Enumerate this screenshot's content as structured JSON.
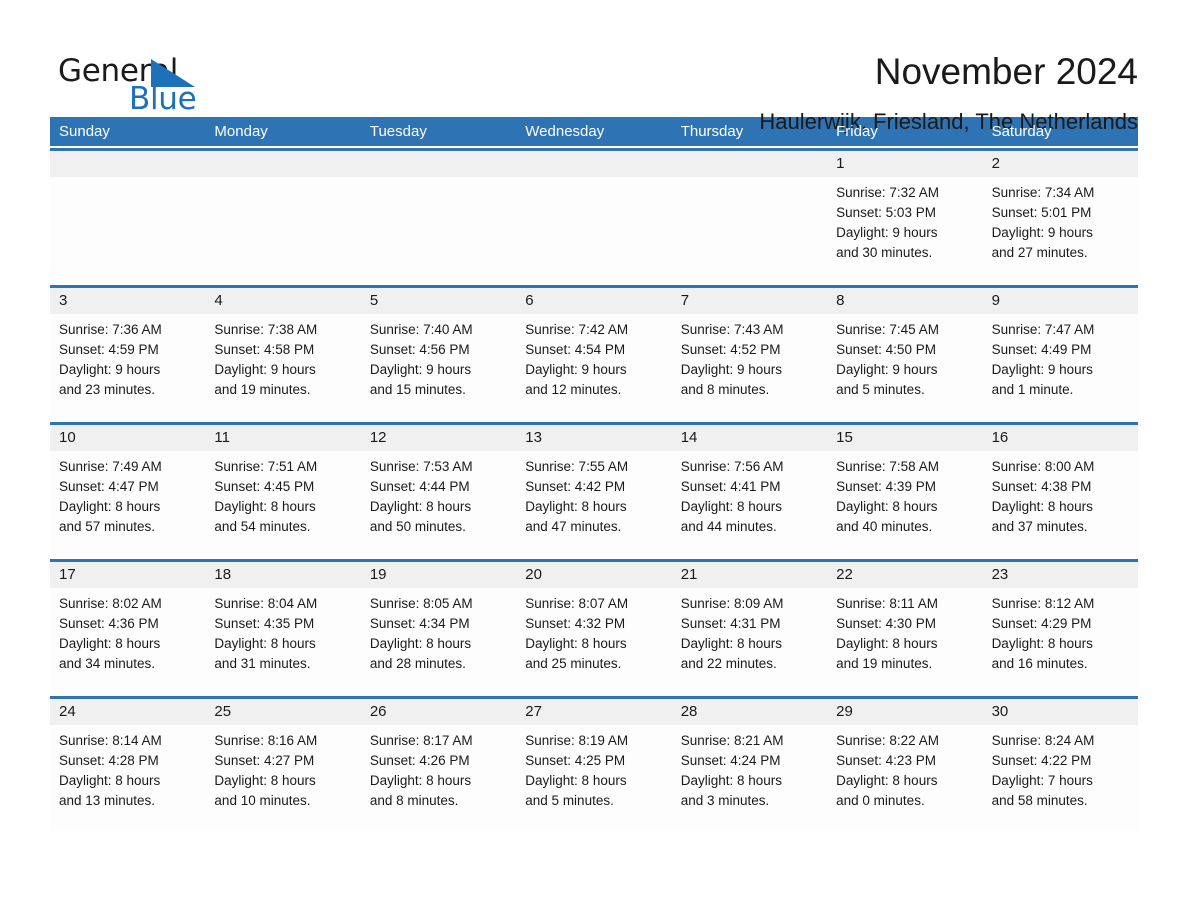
{
  "logo": {
    "word_one": "General",
    "word_two": "Blue",
    "triangle_color": "#1e71b8"
  },
  "header": {
    "title": "November 2024",
    "location": "Haulerwijk, Friesland, The Netherlands"
  },
  "theme": {
    "header_blue": "#2e74b5",
    "date_band_gray": "#f0f0f0",
    "cell_background": "#fdfdfd",
    "text_color": "#1a1a1a"
  },
  "calendar": {
    "weekdays": [
      "Sunday",
      "Monday",
      "Tuesday",
      "Wednesday",
      "Thursday",
      "Friday",
      "Saturday"
    ],
    "weeks": [
      [
        {
          "date": "",
          "sunrise": "",
          "sunset": "",
          "daylight_line1": "",
          "daylight_line2": ""
        },
        {
          "date": "",
          "sunrise": "",
          "sunset": "",
          "daylight_line1": "",
          "daylight_line2": ""
        },
        {
          "date": "",
          "sunrise": "",
          "sunset": "",
          "daylight_line1": "",
          "daylight_line2": ""
        },
        {
          "date": "",
          "sunrise": "",
          "sunset": "",
          "daylight_line1": "",
          "daylight_line2": ""
        },
        {
          "date": "",
          "sunrise": "",
          "sunset": "",
          "daylight_line1": "",
          "daylight_line2": ""
        },
        {
          "date": "1",
          "sunrise": "Sunrise: 7:32 AM",
          "sunset": "Sunset: 5:03 PM",
          "daylight_line1": "Daylight: 9 hours",
          "daylight_line2": "and 30 minutes."
        },
        {
          "date": "2",
          "sunrise": "Sunrise: 7:34 AM",
          "sunset": "Sunset: 5:01 PM",
          "daylight_line1": "Daylight: 9 hours",
          "daylight_line2": "and 27 minutes."
        }
      ],
      [
        {
          "date": "3",
          "sunrise": "Sunrise: 7:36 AM",
          "sunset": "Sunset: 4:59 PM",
          "daylight_line1": "Daylight: 9 hours",
          "daylight_line2": "and 23 minutes."
        },
        {
          "date": "4",
          "sunrise": "Sunrise: 7:38 AM",
          "sunset": "Sunset: 4:58 PM",
          "daylight_line1": "Daylight: 9 hours",
          "daylight_line2": "and 19 minutes."
        },
        {
          "date": "5",
          "sunrise": "Sunrise: 7:40 AM",
          "sunset": "Sunset: 4:56 PM",
          "daylight_line1": "Daylight: 9 hours",
          "daylight_line2": "and 15 minutes."
        },
        {
          "date": "6",
          "sunrise": "Sunrise: 7:42 AM",
          "sunset": "Sunset: 4:54 PM",
          "daylight_line1": "Daylight: 9 hours",
          "daylight_line2": "and 12 minutes."
        },
        {
          "date": "7",
          "sunrise": "Sunrise: 7:43 AM",
          "sunset": "Sunset: 4:52 PM",
          "daylight_line1": "Daylight: 9 hours",
          "daylight_line2": "and 8 minutes."
        },
        {
          "date": "8",
          "sunrise": "Sunrise: 7:45 AM",
          "sunset": "Sunset: 4:50 PM",
          "daylight_line1": "Daylight: 9 hours",
          "daylight_line2": "and 5 minutes."
        },
        {
          "date": "9",
          "sunrise": "Sunrise: 7:47 AM",
          "sunset": "Sunset: 4:49 PM",
          "daylight_line1": "Daylight: 9 hours",
          "daylight_line2": "and 1 minute."
        }
      ],
      [
        {
          "date": "10",
          "sunrise": "Sunrise: 7:49 AM",
          "sunset": "Sunset: 4:47 PM",
          "daylight_line1": "Daylight: 8 hours",
          "daylight_line2": "and 57 minutes."
        },
        {
          "date": "11",
          "sunrise": "Sunrise: 7:51 AM",
          "sunset": "Sunset: 4:45 PM",
          "daylight_line1": "Daylight: 8 hours",
          "daylight_line2": "and 54 minutes."
        },
        {
          "date": "12",
          "sunrise": "Sunrise: 7:53 AM",
          "sunset": "Sunset: 4:44 PM",
          "daylight_line1": "Daylight: 8 hours",
          "daylight_line2": "and 50 minutes."
        },
        {
          "date": "13",
          "sunrise": "Sunrise: 7:55 AM",
          "sunset": "Sunset: 4:42 PM",
          "daylight_line1": "Daylight: 8 hours",
          "daylight_line2": "and 47 minutes."
        },
        {
          "date": "14",
          "sunrise": "Sunrise: 7:56 AM",
          "sunset": "Sunset: 4:41 PM",
          "daylight_line1": "Daylight: 8 hours",
          "daylight_line2": "and 44 minutes."
        },
        {
          "date": "15",
          "sunrise": "Sunrise: 7:58 AM",
          "sunset": "Sunset: 4:39 PM",
          "daylight_line1": "Daylight: 8 hours",
          "daylight_line2": "and 40 minutes."
        },
        {
          "date": "16",
          "sunrise": "Sunrise: 8:00 AM",
          "sunset": "Sunset: 4:38 PM",
          "daylight_line1": "Daylight: 8 hours",
          "daylight_line2": "and 37 minutes."
        }
      ],
      [
        {
          "date": "17",
          "sunrise": "Sunrise: 8:02 AM",
          "sunset": "Sunset: 4:36 PM",
          "daylight_line1": "Daylight: 8 hours",
          "daylight_line2": "and 34 minutes."
        },
        {
          "date": "18",
          "sunrise": "Sunrise: 8:04 AM",
          "sunset": "Sunset: 4:35 PM",
          "daylight_line1": "Daylight: 8 hours",
          "daylight_line2": "and 31 minutes."
        },
        {
          "date": "19",
          "sunrise": "Sunrise: 8:05 AM",
          "sunset": "Sunset: 4:34 PM",
          "daylight_line1": "Daylight: 8 hours",
          "daylight_line2": "and 28 minutes."
        },
        {
          "date": "20",
          "sunrise": "Sunrise: 8:07 AM",
          "sunset": "Sunset: 4:32 PM",
          "daylight_line1": "Daylight: 8 hours",
          "daylight_line2": "and 25 minutes."
        },
        {
          "date": "21",
          "sunrise": "Sunrise: 8:09 AM",
          "sunset": "Sunset: 4:31 PM",
          "daylight_line1": "Daylight: 8 hours",
          "daylight_line2": "and 22 minutes."
        },
        {
          "date": "22",
          "sunrise": "Sunrise: 8:11 AM",
          "sunset": "Sunset: 4:30 PM",
          "daylight_line1": "Daylight: 8 hours",
          "daylight_line2": "and 19 minutes."
        },
        {
          "date": "23",
          "sunrise": "Sunrise: 8:12 AM",
          "sunset": "Sunset: 4:29 PM",
          "daylight_line1": "Daylight: 8 hours",
          "daylight_line2": "and 16 minutes."
        }
      ],
      [
        {
          "date": "24",
          "sunrise": "Sunrise: 8:14 AM",
          "sunset": "Sunset: 4:28 PM",
          "daylight_line1": "Daylight: 8 hours",
          "daylight_line2": "and 13 minutes."
        },
        {
          "date": "25",
          "sunrise": "Sunrise: 8:16 AM",
          "sunset": "Sunset: 4:27 PM",
          "daylight_line1": "Daylight: 8 hours",
          "daylight_line2": "and 10 minutes."
        },
        {
          "date": "26",
          "sunrise": "Sunrise: 8:17 AM",
          "sunset": "Sunset: 4:26 PM",
          "daylight_line1": "Daylight: 8 hours",
          "daylight_line2": "and 8 minutes."
        },
        {
          "date": "27",
          "sunrise": "Sunrise: 8:19 AM",
          "sunset": "Sunset: 4:25 PM",
          "daylight_line1": "Daylight: 8 hours",
          "daylight_line2": "and 5 minutes."
        },
        {
          "date": "28",
          "sunrise": "Sunrise: 8:21 AM",
          "sunset": "Sunset: 4:24 PM",
          "daylight_line1": "Daylight: 8 hours",
          "daylight_line2": "and 3 minutes."
        },
        {
          "date": "29",
          "sunrise": "Sunrise: 8:22 AM",
          "sunset": "Sunset: 4:23 PM",
          "daylight_line1": "Daylight: 8 hours",
          "daylight_line2": "and 0 minutes."
        },
        {
          "date": "30",
          "sunrise": "Sunrise: 8:24 AM",
          "sunset": "Sunset: 4:22 PM",
          "daylight_line1": "Daylight: 7 hours",
          "daylight_line2": "and 58 minutes."
        }
      ]
    ]
  }
}
